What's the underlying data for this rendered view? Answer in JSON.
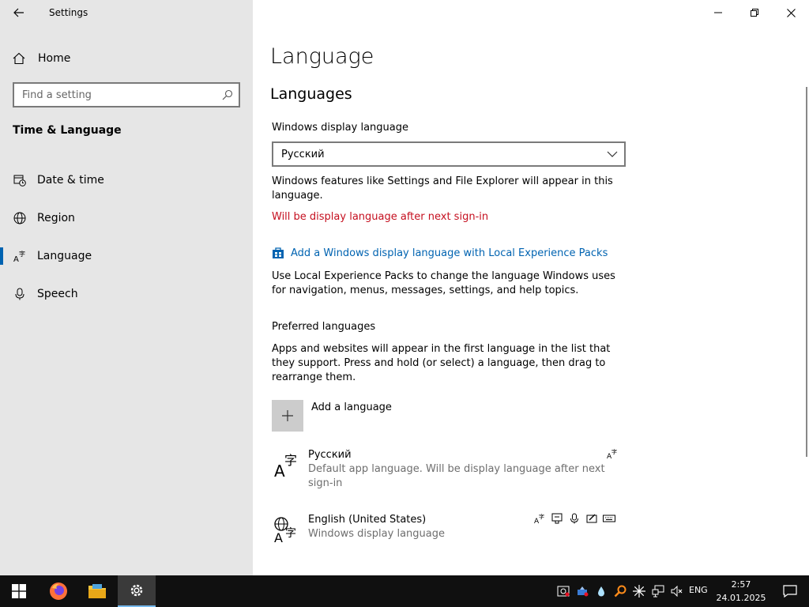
{
  "window": {
    "title": "Settings",
    "controls": [
      "minimize-icon",
      "restore-icon",
      "close-icon"
    ]
  },
  "sidebar": {
    "home_label": "Home",
    "search_placeholder": "Find a setting",
    "section_title": "Time & Language",
    "items": [
      {
        "label": "Date & time",
        "icon": "calendar-clock-icon",
        "selected": false
      },
      {
        "label": "Region",
        "icon": "globe-icon",
        "selected": false
      },
      {
        "label": "Language",
        "icon": "language-icon",
        "selected": true
      },
      {
        "label": "Speech",
        "icon": "microphone-icon",
        "selected": false
      }
    ]
  },
  "main": {
    "page_title": "Language",
    "section_title": "Languages",
    "display_language": {
      "label": "Windows display language",
      "selected": "Русский",
      "description": "Windows features like Settings and File Explorer will appear in this language.",
      "warning": "Will be display language after next sign-in"
    },
    "lxp_link": {
      "label": "Add a Windows display language with Local Experience Packs",
      "description": "Use Local Experience Packs to change the language Windows uses for navigation, menus, messages, settings, and help topics."
    },
    "preferred": {
      "title": "Preferred languages",
      "description": "Apps and websites will appear in the first language in the list that they support. Press and hold (or select) a language, then drag to rearrange them.",
      "add_label": "Add a language",
      "languages": [
        {
          "name": "Русский",
          "desc": "Default app language. Will be display language after next sign-in",
          "icon": "language-icon",
          "features": [
            "display-language-icon"
          ]
        },
        {
          "name": "English (United States)",
          "desc": "Windows display language",
          "icon": "globe-language-icon",
          "features": [
            "display-language-icon",
            "text-to-speech-icon",
            "speech-recognition-icon",
            "handwriting-icon",
            "keyboard-icon"
          ]
        }
      ]
    }
  },
  "taskbar": {
    "apps": [
      "windows-start-icon",
      "firefox-icon",
      "file-explorer-icon",
      "settings-icon"
    ],
    "active_app": "settings-icon",
    "tray_icons": [
      "tray-app-icon",
      "tray-app2-icon",
      "water-drop-icon",
      "search-tool-icon",
      "snowflake-icon",
      "network-icon",
      "volume-muted-icon"
    ],
    "language": "ENG",
    "time": "2:57",
    "date": "24.01.2025"
  }
}
